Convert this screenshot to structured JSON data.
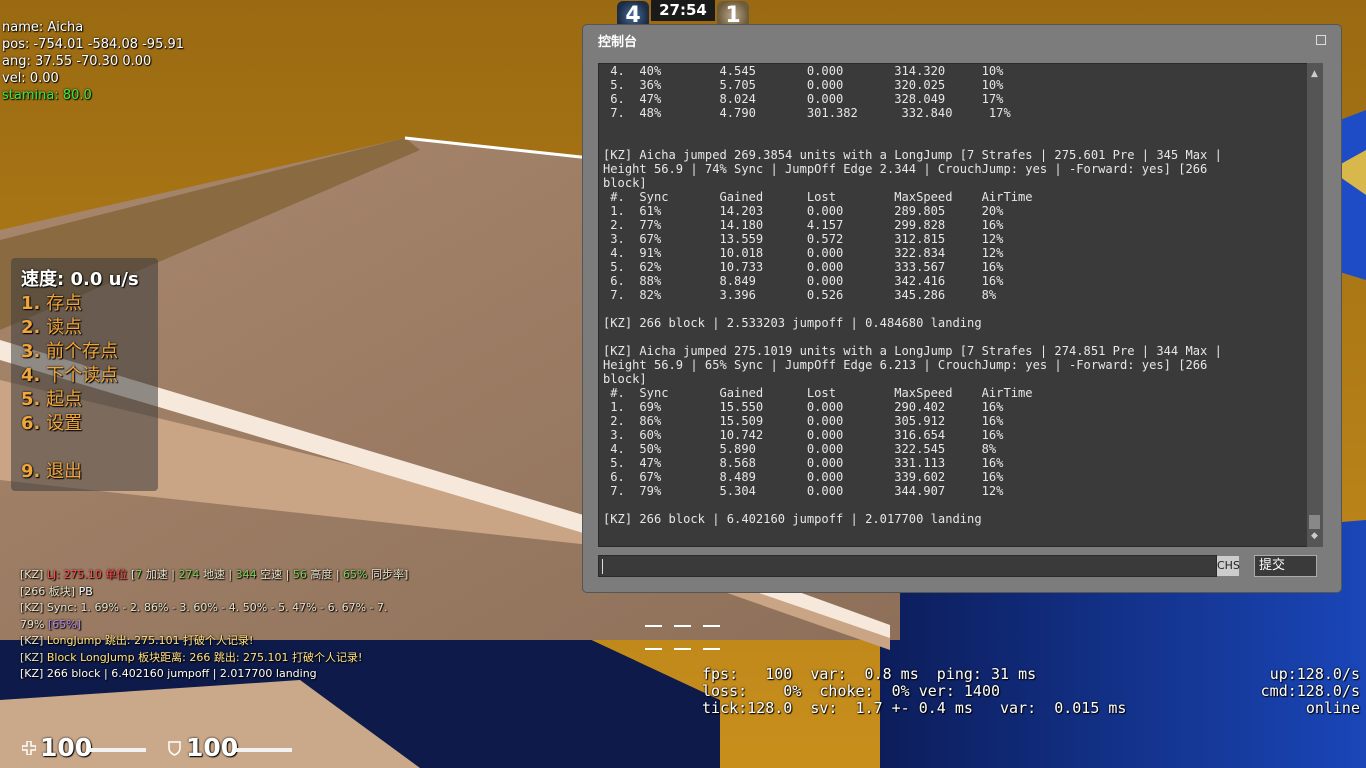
{
  "debug": {
    "name": "name: Aicha",
    "pos": "pos:  -754.01 -584.08 -95.91",
    "ang": "ang:  37.55 -70.30 0.00",
    "vel": "vel:  0.00",
    "stamina": "stamina:  80.0"
  },
  "scoreboard": {
    "ct_score": "4",
    "t_score": "1",
    "timer": "27:54"
  },
  "menu": {
    "title": "速度: 0.0 u/s",
    "items": [
      {
        "num": "1.",
        "label": "存点"
      },
      {
        "num": "2.",
        "label": "读点"
      },
      {
        "num": "3.",
        "label": "前个存点"
      },
      {
        "num": "4.",
        "label": "下个读点"
      },
      {
        "num": "5.",
        "label": "起点"
      },
      {
        "num": "6.",
        "label": "设置"
      },
      {
        "num": "9.",
        "label": "退出"
      }
    ]
  },
  "chat": {
    "line1": {
      "tag": "[KZ]",
      "lj": "LJ:",
      "dist": "275.10 单位",
      "p1": "[",
      "strafes": "7",
      "t1": "加速 |",
      "pre": "274",
      "t2": "地速 |",
      "max": "344",
      "t3": "空速 |",
      "height": "56",
      "t4": "高度 |",
      "sync": "65%",
      "t5": "同步率]"
    },
    "line2": {
      "block": "[266",
      "block_label": "板块]",
      "pb": "PB"
    },
    "line3": {
      "tag": "[KZ]",
      "sync": "Sync: 1. 69% - 2. 86% - 3. 60% - 4. 50% - 5. 47% - 6. 67% - 7."
    },
    "line4": {
      "val": "79%",
      "avg": "[65%]"
    },
    "line5": {
      "tag": "[KZ]",
      "text": "LongJump 跳出: 275.101 打破个人记录!"
    },
    "line6": {
      "tag": "[KZ]",
      "text": "Block LongJump 板块距离: 266 跳出: 275.101 打破个人记录!"
    },
    "line7": {
      "text": "[KZ] 266 block | 6.402160 jumpoff | 2.017700 landing"
    }
  },
  "hud": {
    "health": "100",
    "armor": "100",
    "health_fill": 1.0,
    "armor_fill": 1.0
  },
  "netgraph": {
    "row1_left": "fps:   100  var:  0.8 ms  ping: 31 ms",
    "row1_right": "up:128.0/s",
    "row2_left": "loss:    0%  choke:  0% ver: 1400",
    "row2_right": "cmd:128.0/s",
    "row3_left": "tick:128.0  sv:  1.7 +- 0.4 ms   var:  0.015 ms",
    "row3_right": "online"
  },
  "console": {
    "title": "控制台",
    "log": " 4.  40%        4.545       0.000       314.320     10%\n 5.  36%        5.705       0.000       320.025     10%\n 6.  47%        8.024       0.000       328.049     17%\n 7.  48%        4.790       301.382      332.840     17%\n\n\n[KZ] Aicha jumped 269.3854 units with a LongJump [7 Strafes | 275.601 Pre | 345 Max |\nHeight 56.9 | 74% Sync | JumpOff Edge 2.344 | CrouchJump: yes | -Forward: yes] [266\nblock]\n #.  Sync       Gained      Lost        MaxSpeed    AirTime\n 1.  61%        14.203      0.000       289.805     20%\n 2.  77%        14.180      4.157       299.828     16%\n 3.  67%        13.559      0.572       312.815     12%\n 4.  91%        10.018      0.000       322.834     12%\n 5.  62%        10.733      0.000       333.567     16%\n 6.  88%        8.849       0.000       342.416     16%\n 7.  82%        3.396       0.526       345.286     8%\n\n[KZ] 266 block | 2.533203 jumpoff | 0.484680 landing\n\n[KZ] Aicha jumped 275.1019 units with a LongJump [7 Strafes | 274.851 Pre | 344 Max |\nHeight 56.9 | 65% Sync | JumpOff Edge 6.213 | CrouchJump: yes | -Forward: yes] [266\nblock]\n #.  Sync       Gained      Lost        MaxSpeed    AirTime\n 1.  69%        15.550      0.000       290.402     16%\n 2.  86%        15.509      0.000       305.912     16%\n 3.  60%        10.742      0.000       316.654     16%\n 4.  50%        5.890       0.000       322.545     8%\n 5.  47%        8.568       0.000       331.113     16%\n 6.  67%        8.489       0.000       339.602     16%\n 7.  79%        5.304       0.000       344.907     12%\n\n[KZ] 266 block | 6.402160 jumpoff | 2.017700 landing",
    "input_value": "",
    "ime_label": "CHS",
    "submit_label": "提交"
  }
}
